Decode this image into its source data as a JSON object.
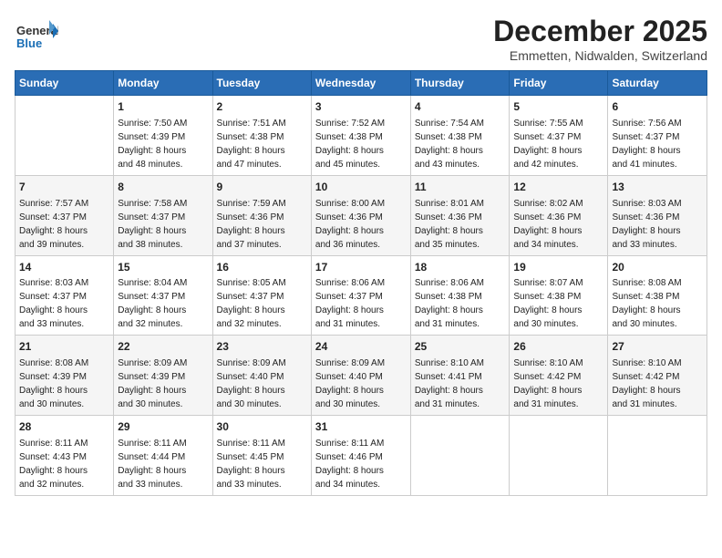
{
  "header": {
    "logo_general": "General",
    "logo_blue": "Blue",
    "month_year": "December 2025",
    "location": "Emmetten, Nidwalden, Switzerland"
  },
  "days_of_week": [
    "Sunday",
    "Monday",
    "Tuesday",
    "Wednesday",
    "Thursday",
    "Friday",
    "Saturday"
  ],
  "weeks": [
    [
      {
        "day": "",
        "info": ""
      },
      {
        "day": "1",
        "info": "Sunrise: 7:50 AM\nSunset: 4:39 PM\nDaylight: 8 hours\nand 48 minutes."
      },
      {
        "day": "2",
        "info": "Sunrise: 7:51 AM\nSunset: 4:38 PM\nDaylight: 8 hours\nand 47 minutes."
      },
      {
        "day": "3",
        "info": "Sunrise: 7:52 AM\nSunset: 4:38 PM\nDaylight: 8 hours\nand 45 minutes."
      },
      {
        "day": "4",
        "info": "Sunrise: 7:54 AM\nSunset: 4:38 PM\nDaylight: 8 hours\nand 43 minutes."
      },
      {
        "day": "5",
        "info": "Sunrise: 7:55 AM\nSunset: 4:37 PM\nDaylight: 8 hours\nand 42 minutes."
      },
      {
        "day": "6",
        "info": "Sunrise: 7:56 AM\nSunset: 4:37 PM\nDaylight: 8 hours\nand 41 minutes."
      }
    ],
    [
      {
        "day": "7",
        "info": "Sunrise: 7:57 AM\nSunset: 4:37 PM\nDaylight: 8 hours\nand 39 minutes."
      },
      {
        "day": "8",
        "info": "Sunrise: 7:58 AM\nSunset: 4:37 PM\nDaylight: 8 hours\nand 38 minutes."
      },
      {
        "day": "9",
        "info": "Sunrise: 7:59 AM\nSunset: 4:36 PM\nDaylight: 8 hours\nand 37 minutes."
      },
      {
        "day": "10",
        "info": "Sunrise: 8:00 AM\nSunset: 4:36 PM\nDaylight: 8 hours\nand 36 minutes."
      },
      {
        "day": "11",
        "info": "Sunrise: 8:01 AM\nSunset: 4:36 PM\nDaylight: 8 hours\nand 35 minutes."
      },
      {
        "day": "12",
        "info": "Sunrise: 8:02 AM\nSunset: 4:36 PM\nDaylight: 8 hours\nand 34 minutes."
      },
      {
        "day": "13",
        "info": "Sunrise: 8:03 AM\nSunset: 4:36 PM\nDaylight: 8 hours\nand 33 minutes."
      }
    ],
    [
      {
        "day": "14",
        "info": "Sunrise: 8:03 AM\nSunset: 4:37 PM\nDaylight: 8 hours\nand 33 minutes."
      },
      {
        "day": "15",
        "info": "Sunrise: 8:04 AM\nSunset: 4:37 PM\nDaylight: 8 hours\nand 32 minutes."
      },
      {
        "day": "16",
        "info": "Sunrise: 8:05 AM\nSunset: 4:37 PM\nDaylight: 8 hours\nand 32 minutes."
      },
      {
        "day": "17",
        "info": "Sunrise: 8:06 AM\nSunset: 4:37 PM\nDaylight: 8 hours\nand 31 minutes."
      },
      {
        "day": "18",
        "info": "Sunrise: 8:06 AM\nSunset: 4:38 PM\nDaylight: 8 hours\nand 31 minutes."
      },
      {
        "day": "19",
        "info": "Sunrise: 8:07 AM\nSunset: 4:38 PM\nDaylight: 8 hours\nand 30 minutes."
      },
      {
        "day": "20",
        "info": "Sunrise: 8:08 AM\nSunset: 4:38 PM\nDaylight: 8 hours\nand 30 minutes."
      }
    ],
    [
      {
        "day": "21",
        "info": "Sunrise: 8:08 AM\nSunset: 4:39 PM\nDaylight: 8 hours\nand 30 minutes."
      },
      {
        "day": "22",
        "info": "Sunrise: 8:09 AM\nSunset: 4:39 PM\nDaylight: 8 hours\nand 30 minutes."
      },
      {
        "day": "23",
        "info": "Sunrise: 8:09 AM\nSunset: 4:40 PM\nDaylight: 8 hours\nand 30 minutes."
      },
      {
        "day": "24",
        "info": "Sunrise: 8:09 AM\nSunset: 4:40 PM\nDaylight: 8 hours\nand 30 minutes."
      },
      {
        "day": "25",
        "info": "Sunrise: 8:10 AM\nSunset: 4:41 PM\nDaylight: 8 hours\nand 31 minutes."
      },
      {
        "day": "26",
        "info": "Sunrise: 8:10 AM\nSunset: 4:42 PM\nDaylight: 8 hours\nand 31 minutes."
      },
      {
        "day": "27",
        "info": "Sunrise: 8:10 AM\nSunset: 4:42 PM\nDaylight: 8 hours\nand 31 minutes."
      }
    ],
    [
      {
        "day": "28",
        "info": "Sunrise: 8:11 AM\nSunset: 4:43 PM\nDaylight: 8 hours\nand 32 minutes."
      },
      {
        "day": "29",
        "info": "Sunrise: 8:11 AM\nSunset: 4:44 PM\nDaylight: 8 hours\nand 33 minutes."
      },
      {
        "day": "30",
        "info": "Sunrise: 8:11 AM\nSunset: 4:45 PM\nDaylight: 8 hours\nand 33 minutes."
      },
      {
        "day": "31",
        "info": "Sunrise: 8:11 AM\nSunset: 4:46 PM\nDaylight: 8 hours\nand 34 minutes."
      },
      {
        "day": "",
        "info": ""
      },
      {
        "day": "",
        "info": ""
      },
      {
        "day": "",
        "info": ""
      }
    ]
  ]
}
